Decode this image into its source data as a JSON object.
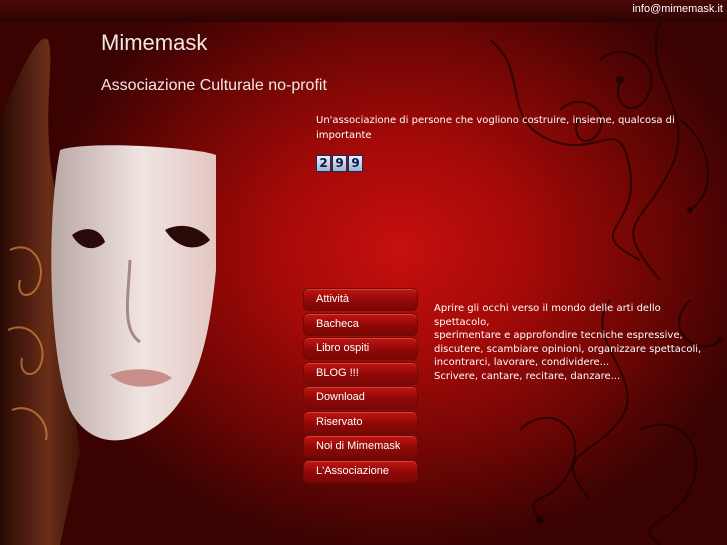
{
  "header": {
    "email": "info@mimemask.it",
    "title": "Mimemask",
    "subtitle": "Associazione Culturale no-profit"
  },
  "intro": "Un'associazione di persone che vogliono costruire, insieme, qualcosa di importante",
  "counter": {
    "digits": [
      "2",
      "9",
      "9"
    ],
    "value": 299
  },
  "menu": {
    "items": [
      {
        "label": "Attività"
      },
      {
        "label": "Bacheca"
      },
      {
        "label": "Libro ospiti"
      },
      {
        "label": "BLOG !!!"
      },
      {
        "label": "Download"
      },
      {
        "label": "Riservato"
      },
      {
        "label": "Noi di Mimemask"
      },
      {
        "label": "L'Associazione"
      }
    ]
  },
  "description": {
    "lines": [
      "Aprire gli occhi verso il mondo delle arti dello spettacolo,",
      "sperimentare e approfondire tecniche espressive, discutere, scambiare opinioni, organizzare spettacoli,",
      "incontrarci, lavorare, condividere...",
      "Scrivere, cantare, recitare, danzare..."
    ]
  },
  "colors": {
    "background": "#a50a08",
    "menu_button": "#8f0907",
    "text": "#ffffff"
  },
  "icons": {
    "mask": "theatre-mask-image",
    "ornament": "swirl-ornament"
  }
}
